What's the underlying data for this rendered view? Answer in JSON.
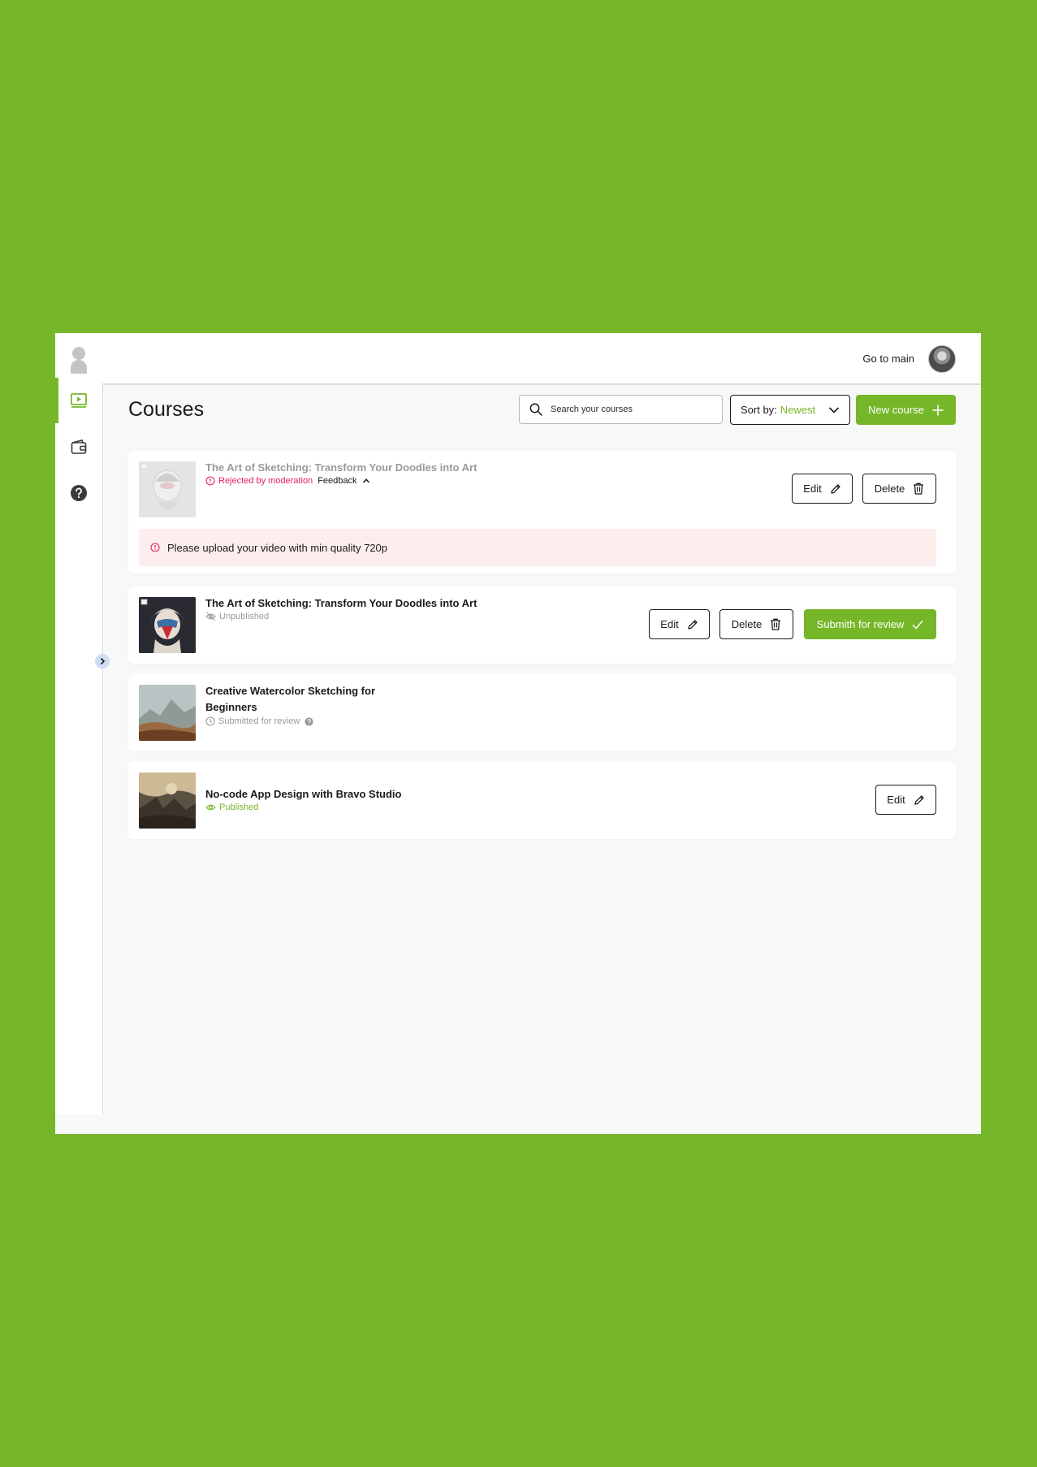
{
  "topbar": {
    "go_to_main": "Go to main"
  },
  "page": {
    "title": "Courses"
  },
  "search": {
    "placeholder": "Search your courses"
  },
  "sort": {
    "label": "Sort by:",
    "value": "Newest"
  },
  "new_course": {
    "label": "New course"
  },
  "courses": [
    {
      "title": "The Art of Sketching: Transform Your Doodles into Art",
      "status": "Rejected by moderation",
      "feedback_label": "Feedback",
      "notice": "Please upload your video with min quality 720p",
      "edit": "Edit",
      "delete": "Delete"
    },
    {
      "title": "The Art of Sketching: Transform Your Doodles into Art",
      "status": "Unpublished",
      "edit": "Edit",
      "delete": "Delete",
      "submit": "Submith for review"
    },
    {
      "title_line1": "Creative Watercolor Sketching for",
      "title_line2": "Beginners",
      "status": "Submitted for review"
    },
    {
      "title": "No-code App Design with Bravo Studio",
      "status": "Published",
      "edit": "Edit"
    }
  ],
  "colors": {
    "accent": "#76b729",
    "rejected": "#e5205c",
    "muted": "#9a9a9a",
    "notice_bg": "#fdeeee"
  }
}
